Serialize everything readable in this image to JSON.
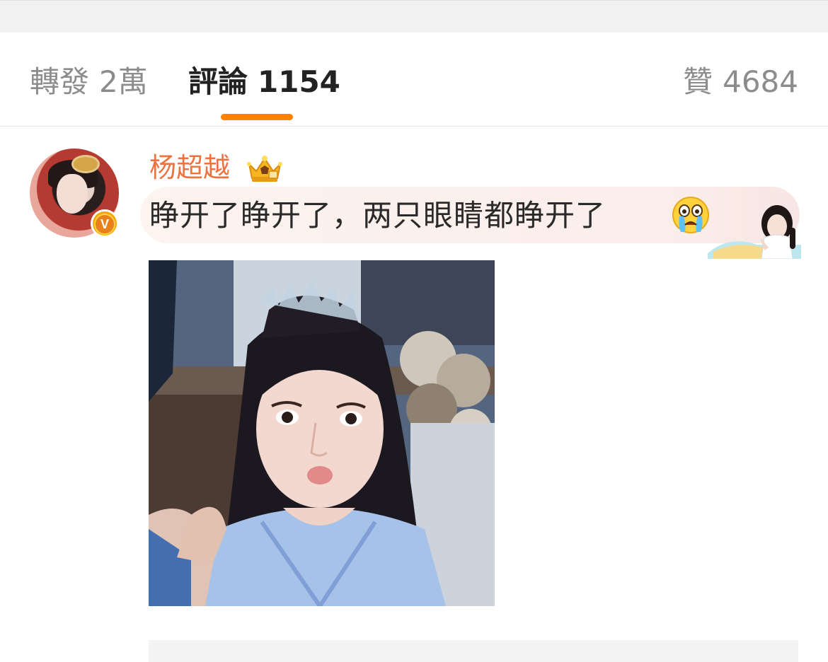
{
  "tabs": {
    "forward": {
      "label": "轉發",
      "count": "2萬"
    },
    "comment": {
      "label": "評論",
      "count": "1154"
    },
    "like": {
      "label": "贊",
      "count": "4684"
    }
  },
  "comment": {
    "username": "杨超越",
    "text": "睁开了睁开了，两只眼睛都睁开了",
    "badge": "V",
    "icons": [
      "crown-icon",
      "crying-face-icon",
      "verified-icon"
    ]
  },
  "colors": {
    "accent": "#ff8200",
    "username": "#eb7340",
    "badge": "#f7a600"
  }
}
